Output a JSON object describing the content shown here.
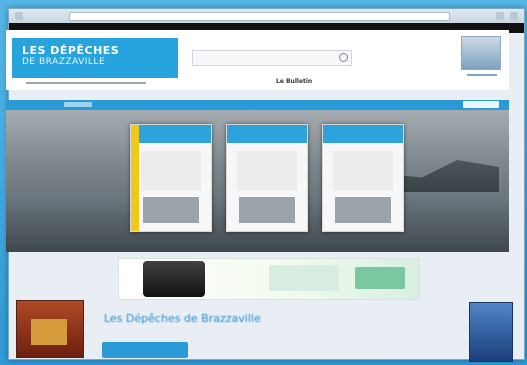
{
  "site": {
    "logo_line1": "LES DÉPÊCHES",
    "logo_line2": "DE BRAZZAVILLE",
    "header_center": "Le Bulletin",
    "section_title": "Les Dépêches de Brazzaville"
  },
  "colors": {
    "brand_blue": "#27a3dd",
    "nav_blue": "#2a9ad6"
  },
  "icons": {
    "search": "search-icon"
  }
}
